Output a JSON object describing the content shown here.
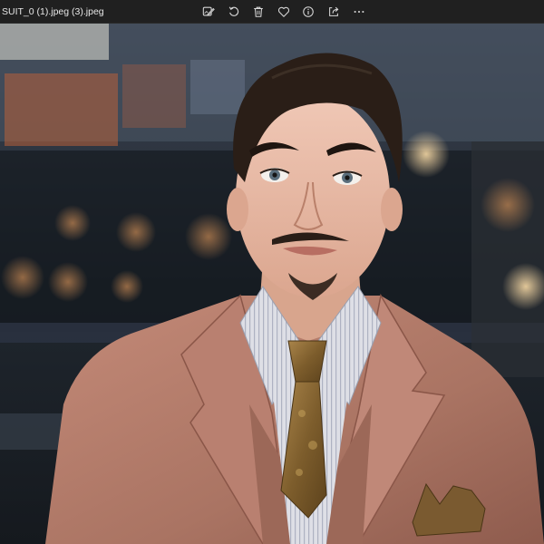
{
  "window": {
    "filename": "SUIT_0 (1).jpeg (3).jpeg"
  },
  "toolbar": {
    "actions": [
      {
        "name": "edit-image",
        "icon": "edit-image-icon"
      },
      {
        "name": "rotate",
        "icon": "rotate-icon"
      },
      {
        "name": "delete",
        "icon": "trash-icon"
      },
      {
        "name": "favorite",
        "icon": "heart-icon"
      },
      {
        "name": "file-info",
        "icon": "info-icon"
      },
      {
        "name": "share",
        "icon": "share-icon"
      },
      {
        "name": "more",
        "icon": "more-icon"
      }
    ]
  },
  "colors": {
    "toolbar_bg": "#202020",
    "icon": "#d8d8d8",
    "suit": "#b07a6a",
    "tie": "#8a6a34",
    "skin": "#e7b9a6",
    "hair": "#2a1e17"
  }
}
